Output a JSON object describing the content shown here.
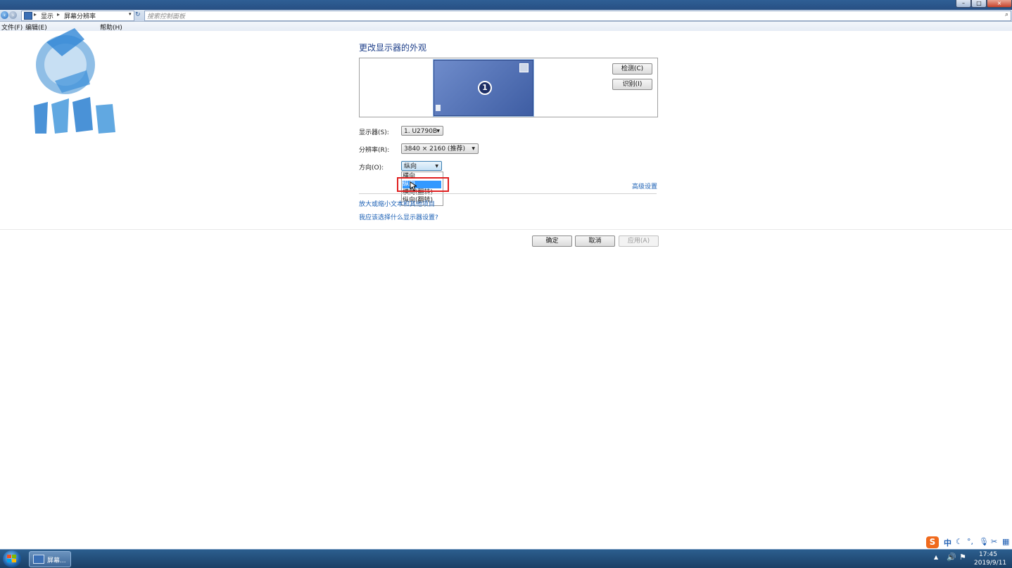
{
  "window": {
    "minimize_label": "–",
    "maximize_label": "□",
    "close_label": "×"
  },
  "address": {
    "crumb1": "显示",
    "crumb2": "屏幕分辨率",
    "search_placeholder": "搜索控制面板"
  },
  "menu": {
    "file": "文件(F)",
    "edit": "编辑(E)",
    "help": "帮助(H)"
  },
  "page": {
    "heading": "更改显示器的外观",
    "monitor_number": "1",
    "detect_label": "检测(C)",
    "identify_label": "识别(I)",
    "display_label": "显示器(S):",
    "display_value": "1. U2790B",
    "resolution_label": "分辨率(R):",
    "resolution_value": "3840 × 2160 (推荐)",
    "orientation_label": "方向(O):",
    "orientation_value": "纵向",
    "orientation_options": [
      "横向",
      "纵向",
      "横向(翻转)",
      "纵向(翻转)"
    ],
    "advanced_link": "高级设置",
    "enlarge_link": "放大或缩小文本和其他项目",
    "help_link": "我应该选择什么显示器设置?",
    "ok_label": "确定",
    "cancel_label": "取消",
    "apply_label": "应用(A)"
  },
  "taskbar": {
    "task_label": "屏幕...",
    "ime_label": "中",
    "time": "17:45",
    "date": "2019/9/11"
  },
  "colors": {
    "accent": "#1a5fb4",
    "highlight": "#3399ff",
    "callout": "#e02020",
    "monitor": "#4d6db0"
  }
}
